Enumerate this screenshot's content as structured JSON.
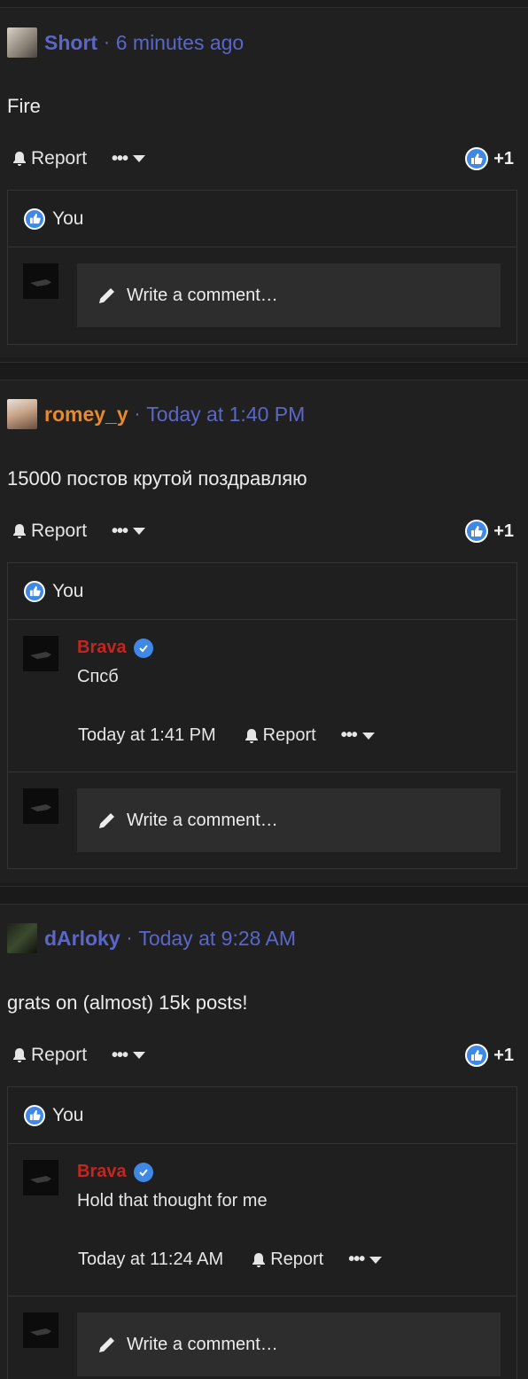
{
  "posts": [
    {
      "username": "Short",
      "username_color": "#5a67c9",
      "time": "6 minutes ago",
      "text": "Fire",
      "report_label": "Report",
      "reaction_count": "+1",
      "reacted_by": "You",
      "comment_placeholder": "Write a comment…",
      "replies": []
    },
    {
      "username": "romey_y",
      "username_color": "#e8892a",
      "time": "Today at 1:40 PM",
      "text": "15000 постов крутой поздравляю",
      "report_label": "Report",
      "reaction_count": "+1",
      "reacted_by": "You",
      "comment_placeholder": "Write a comment…",
      "replies": [
        {
          "username": "Brava",
          "text": "Спсб",
          "time": "Today at 1:41 PM",
          "report_label": "Report"
        }
      ]
    },
    {
      "username": "dArloky",
      "username_color": "#5a67c9",
      "time": "Today at 9:28 AM",
      "text": "grats on (almost) 15k posts!",
      "report_label": "Report",
      "reaction_count": "+1",
      "reacted_by": "You",
      "comment_placeholder": "Write a comment…",
      "replies": [
        {
          "username": "Brava",
          "text": "Hold that thought for me",
          "time": "Today at 11:24 AM",
          "report_label": "Report"
        }
      ]
    }
  ],
  "icons": {
    "bell": "bell-icon",
    "more": "more-dots-icon",
    "caret": "caret-down-icon",
    "like": "thumbs-up-icon",
    "verified": "verified-check-icon",
    "pencil": "pencil-icon"
  },
  "colors": {
    "reply_username": "#c2261f",
    "link_blue": "#5a67c9",
    "like_blue": "#3f88e6"
  }
}
